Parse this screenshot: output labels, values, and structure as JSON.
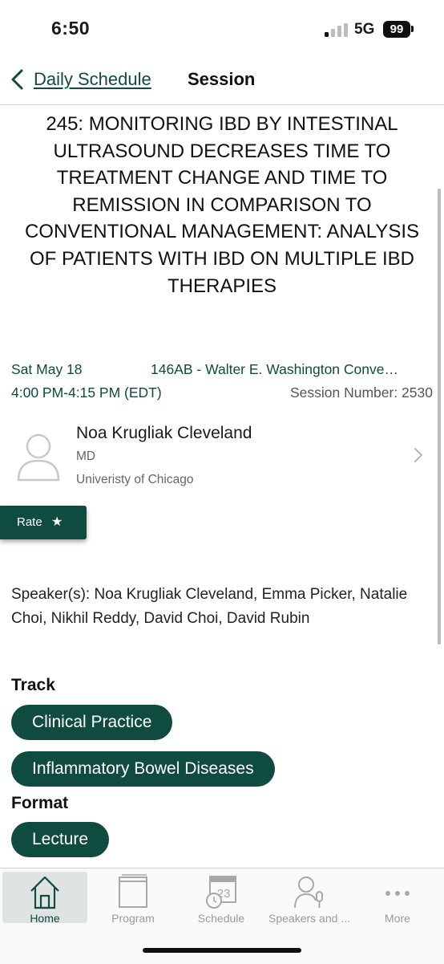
{
  "status_bar": {
    "time": "6:50",
    "network": "5G",
    "battery": "99"
  },
  "header": {
    "back_label": "Daily Schedule",
    "title": "Session"
  },
  "session": {
    "title": "245: MONITORING IBD BY INTESTINAL ULTRASOUND DECREASES TIME TO TREATMENT CHANGE AND TIME TO REMISSION IN COMPARISON TO CONVENTIONAL MANAGEMENT: ANALYSIS OF PATIENTS WITH IBD ON MULTIPLE IBD THERAPIES",
    "date": "Sat May 18",
    "location": "146AB - Walter E. Washington Conve…",
    "time_range": "4:00 PM-4:15 PM (EDT)",
    "session_number": "Session Number: 2530"
  },
  "speaker": {
    "name": "Noa Krugliak Cleveland",
    "degree": "MD",
    "organization": "Univeristy of Chicago"
  },
  "rate": {
    "label": "Rate",
    "icon": "star-icon"
  },
  "speakers_text": "Speaker(s): Noa Krugliak Cleveland, Emma Picker, Natalie Choi, Nikhil Reddy, David Choi, David Rubin",
  "track": {
    "heading": "Track",
    "items": [
      "Clinical Practice",
      "Inflammatory Bowel Diseases"
    ]
  },
  "format": {
    "heading": "Format",
    "items": [
      "Lecture"
    ]
  },
  "tabs": [
    {
      "label": "Home",
      "icon": "home-icon",
      "active": true
    },
    {
      "label": "Program",
      "icon": "book-icon",
      "active": false
    },
    {
      "label": "Schedule",
      "icon": "calendar-clock-icon",
      "calendar_day": "23",
      "active": false
    },
    {
      "label": "Speakers and ...",
      "icon": "speaker-mic-icon",
      "active": false
    },
    {
      "label": "More",
      "icon": "more-dots-icon",
      "active": false
    }
  ],
  "colors": {
    "brand": "#0f4b3e",
    "tab_active_bg": "#dfe3e3",
    "muted_text": "#666666"
  }
}
